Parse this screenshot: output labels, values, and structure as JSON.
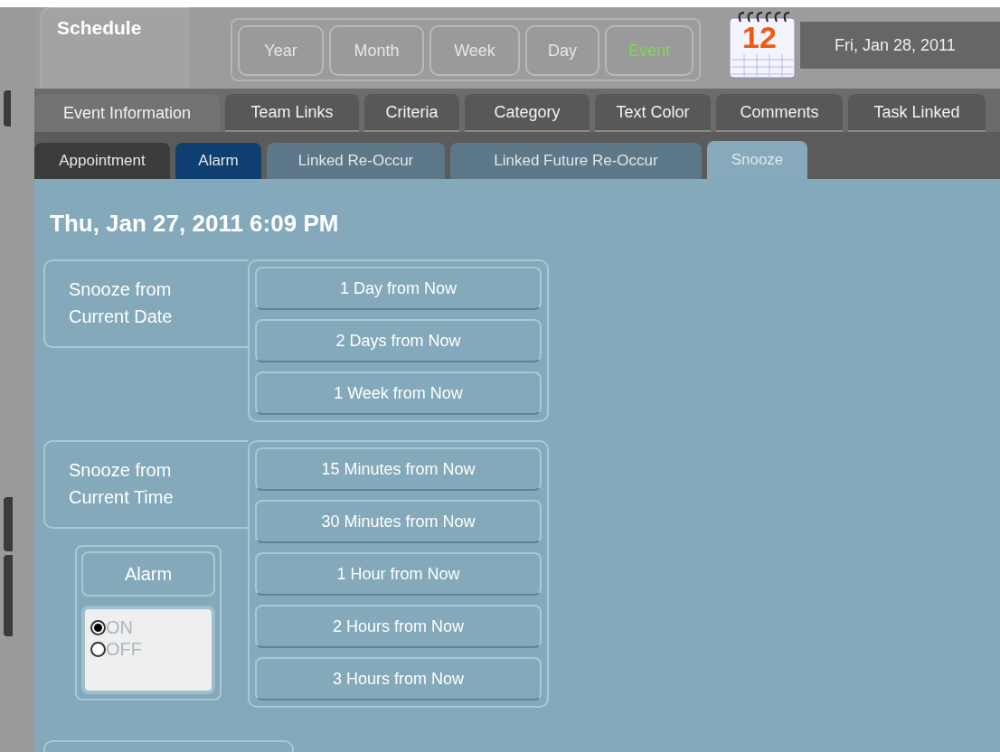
{
  "header": {
    "title": "Schedule",
    "views": [
      {
        "label": "Year",
        "selected": false
      },
      {
        "label": "Month",
        "selected": false
      },
      {
        "label": "Week",
        "selected": false
      },
      {
        "label": "Day",
        "selected": false
      },
      {
        "label": "Event",
        "selected": true
      }
    ],
    "calendar_day": "12",
    "date": "Fri, Jan 28, 2011"
  },
  "tabs": [
    {
      "label": "Event Information",
      "selected": true
    },
    {
      "label": "Team Links",
      "selected": false
    },
    {
      "label": "Criteria",
      "selected": false
    },
    {
      "label": "Category",
      "selected": false
    },
    {
      "label": "Text Color",
      "selected": false
    },
    {
      "label": "Comments",
      "selected": false
    },
    {
      "label": "Task Linked",
      "selected": false
    }
  ],
  "subtabs": [
    {
      "label": "Appointment",
      "selected": false,
      "color": "#3c3c3c"
    },
    {
      "label": "Alarm",
      "selected": false,
      "color": "#0e3f70"
    },
    {
      "label": "Linked Re-Occur",
      "selected": false,
      "color": "#5d7888"
    },
    {
      "label": "Linked Future Re-Occur",
      "selected": false,
      "color": "#5d7888"
    },
    {
      "label": "Snooze",
      "selected": true,
      "color": "#86aabb"
    }
  ],
  "event_time": "Thu, Jan 27, 2011 6:09 PM",
  "groups": [
    {
      "label": [
        "Snooze from",
        "Current Date"
      ],
      "buttons": [
        "1 Day from Now",
        "2 Days from Now",
        "1 Week from Now"
      ]
    },
    {
      "label": [
        "Snooze from",
        "Current Time"
      ],
      "buttons": [
        "15 Minutes from Now",
        "30 Minutes from Now",
        "1 Hour from Now",
        "2 Hours from Now",
        "3 Hours from Now"
      ]
    }
  ],
  "alarm": {
    "title": "Alarm",
    "options": [
      {
        "label": "ON",
        "selected": true
      },
      {
        "label": "OFF",
        "selected": false
      }
    ]
  }
}
